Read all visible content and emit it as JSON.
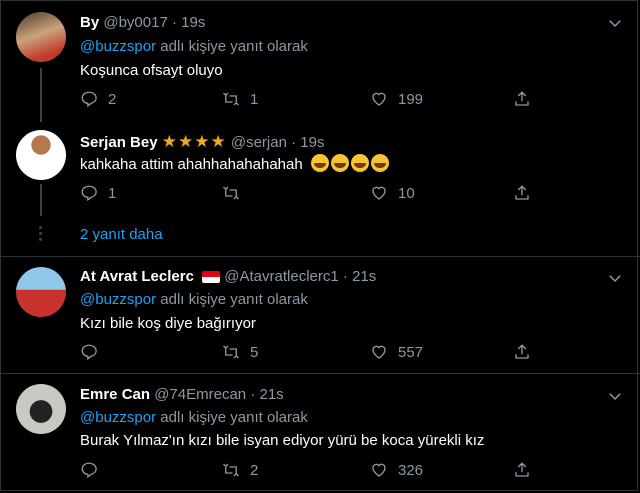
{
  "tweets": [
    {
      "name": "By",
      "handle": "@by0017",
      "sep": "·",
      "time": "19s",
      "reply_link": "@buzzspor",
      "reply_suffix": " adlı kişiye yanıt olarak",
      "text": "Koşunca ofsayt oluyo",
      "replies": "2",
      "retweets": "1",
      "likes": "199"
    },
    {
      "name": "Serjan Bey",
      "stars": "★★★★",
      "handle": "@serjan",
      "sep": "·",
      "time": "19s",
      "text": "kahkaha attim ahahhahahahahah",
      "replies": "1",
      "retweets": "",
      "likes": "10"
    },
    {
      "name": "At Avrat Leclerc",
      "handle": "@Atavratleclerc1",
      "sep": "·",
      "time": "21s",
      "reply_link": "@buzzspor",
      "reply_suffix": " adlı kişiye yanıt olarak",
      "text": "Kızı bile koş diye bağırıyor",
      "replies": "",
      "retweets": "5",
      "likes": "557"
    },
    {
      "name": "Emre Can",
      "handle": "@74Emrecan",
      "sep": "·",
      "time": "21s",
      "reply_link": "@buzzspor",
      "reply_suffix": " adlı kişiye yanıt olarak",
      "text": "Burak Yılmaz'ın kızı bile isyan ediyor yürü be koca yürekli kız",
      "replies": "",
      "retweets": "2",
      "likes": "326"
    }
  ],
  "show_more": "2 yanıt daha",
  "icons": {
    "reply": "reply-icon",
    "retweet": "retweet-icon",
    "like": "heart-icon",
    "share": "share-icon",
    "menu": "chevron-down-icon"
  },
  "colors": {
    "background": "#000000",
    "link": "#1da1f2",
    "muted": "#8b98a5"
  }
}
